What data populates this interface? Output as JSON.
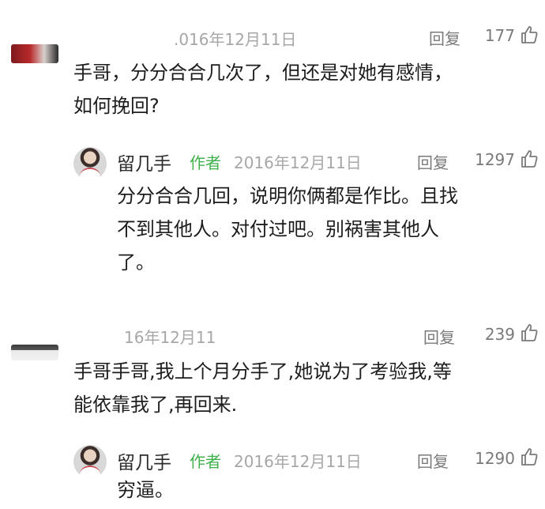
{
  "comments": [
    {
      "date": ".016年12月11日",
      "reply_label": "回复",
      "likes": "177",
      "lines": [
        "手哥，分分合合几次了，但还是对她有感情，",
        "如何挽回?"
      ],
      "reply": {
        "author": "留几手",
        "tag": "作者",
        "date": "2016年12月11日",
        "reply_label": "回复",
        "likes": "1297",
        "lines": [
          "分分合合几回，说明你俩都是作比。且找",
          "不到其他人。对付过吧。别祸害其他人",
          "了。"
        ]
      }
    },
    {
      "date": "16年12月11",
      "reply_label": "回复",
      "likes": "239",
      "lines": [
        "手哥手哥,我上个月分手了,她说为了考验我,等",
        "能依靠我了,再回来."
      ],
      "reply": {
        "author": "留几手",
        "tag": "作者",
        "date": "2016年12月11日",
        "reply_label": "回复",
        "likes": "1290",
        "lines": [
          "穷逼。"
        ]
      }
    }
  ],
  "colors": {
    "author_tag": "#3fb14c",
    "meta_text": "#a7a7a7",
    "action_text": "#7a7a7a"
  },
  "icons": {
    "like": "thumbs-up-icon"
  }
}
